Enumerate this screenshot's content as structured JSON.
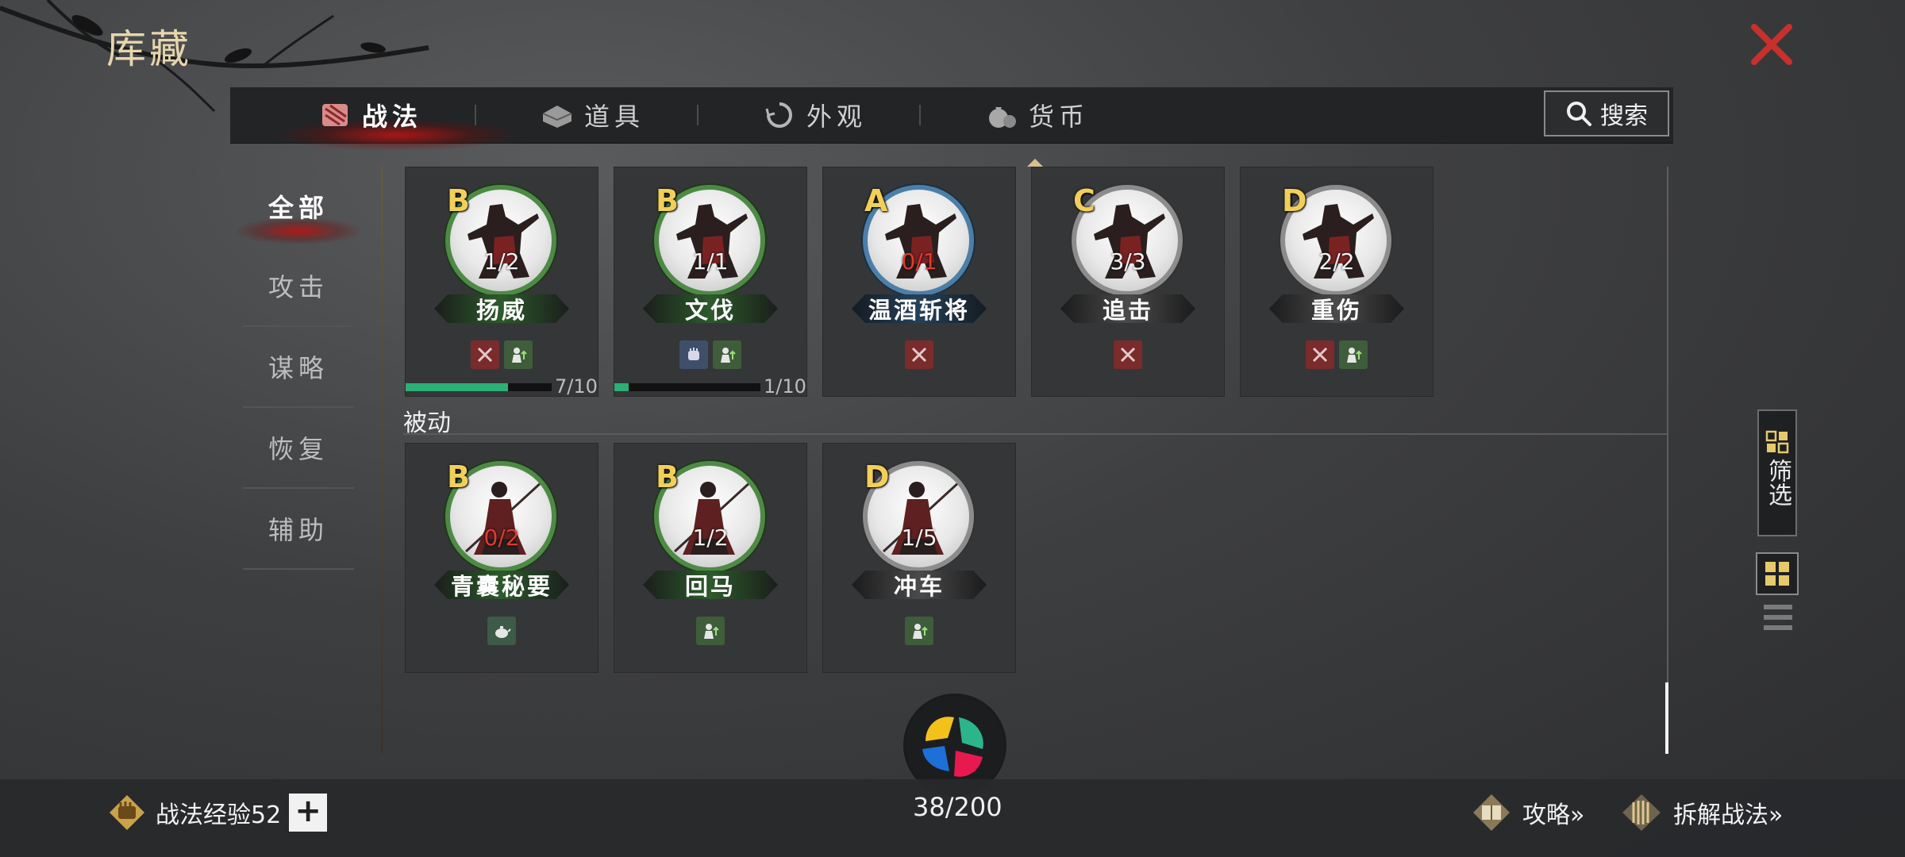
{
  "page": {
    "title": "库藏"
  },
  "tabs": [
    {
      "label": "战法",
      "icon": "scroll-bundle-icon",
      "active": true
    },
    {
      "label": "道具",
      "icon": "box-icon",
      "active": false
    },
    {
      "label": "外观",
      "icon": "swirl-icon",
      "active": false
    },
    {
      "label": "货币",
      "icon": "coin-bag-icon",
      "active": false
    }
  ],
  "search": {
    "label": "搜索"
  },
  "sidebar": {
    "items": [
      {
        "label": "全部",
        "active": true
      },
      {
        "label": "攻击",
        "active": false
      },
      {
        "label": "谋略",
        "active": false
      },
      {
        "label": "恢复",
        "active": false
      },
      {
        "label": "辅助",
        "active": false
      }
    ]
  },
  "cards_active": [
    {
      "grade": "B",
      "count": "1/2",
      "name": "扬威",
      "ring": "green",
      "count_red": false,
      "tags": [
        "sword-crossed-icon",
        "soldier-up-icon"
      ],
      "progress_text": "7/10",
      "progress": 0.7
    },
    {
      "grade": "B",
      "count": "1/1",
      "name": "文伐",
      "ring": "green",
      "count_red": false,
      "tags": [
        "fist-icon",
        "soldier-up-icon"
      ],
      "progress_text": "1/10",
      "progress": 0.1
    },
    {
      "grade": "A",
      "count": "0/1",
      "name": "温酒斩将",
      "ring": "blue",
      "count_red": true,
      "tags": [
        "sword-crossed-icon"
      ]
    },
    {
      "grade": "C",
      "count": "3/3",
      "name": "追击",
      "ring": "gray",
      "count_red": false,
      "tags": [
        "sword-crossed-icon"
      ]
    },
    {
      "grade": "D",
      "count": "2/2",
      "name": "重伤",
      "ring": "gray",
      "count_red": false,
      "tags": [
        "sword-crossed-icon",
        "soldier-up-icon"
      ]
    }
  ],
  "section": {
    "passive_label": "被动"
  },
  "cards_passive": [
    {
      "grade": "B",
      "count": "0/2",
      "name": "青囊秘要",
      "ring": "green",
      "count_red": true,
      "tags": [
        "teapot-icon"
      ]
    },
    {
      "grade": "B",
      "count": "1/2",
      "name": "回马",
      "ring": "green",
      "count_red": false,
      "tags": [
        "soldier-up-icon"
      ]
    },
    {
      "grade": "D",
      "count": "1/5",
      "name": "冲车",
      "ring": "gray",
      "count_red": false,
      "tags": [
        "soldier-up-icon"
      ]
    }
  ],
  "filter": {
    "label": "筛选"
  },
  "bottom": {
    "exp_label": "战法经验52",
    "plus": "+",
    "capacity": "38/200",
    "guide_label": "攻略»",
    "dismantle_label": "拆解战法»"
  },
  "colors": {
    "accent_gold": "#e7d6ad",
    "grade_yellow": "#f2cf57",
    "close_red": "#c9302c",
    "progress_green": "#2bb075",
    "red_count": "#e03b2f"
  }
}
